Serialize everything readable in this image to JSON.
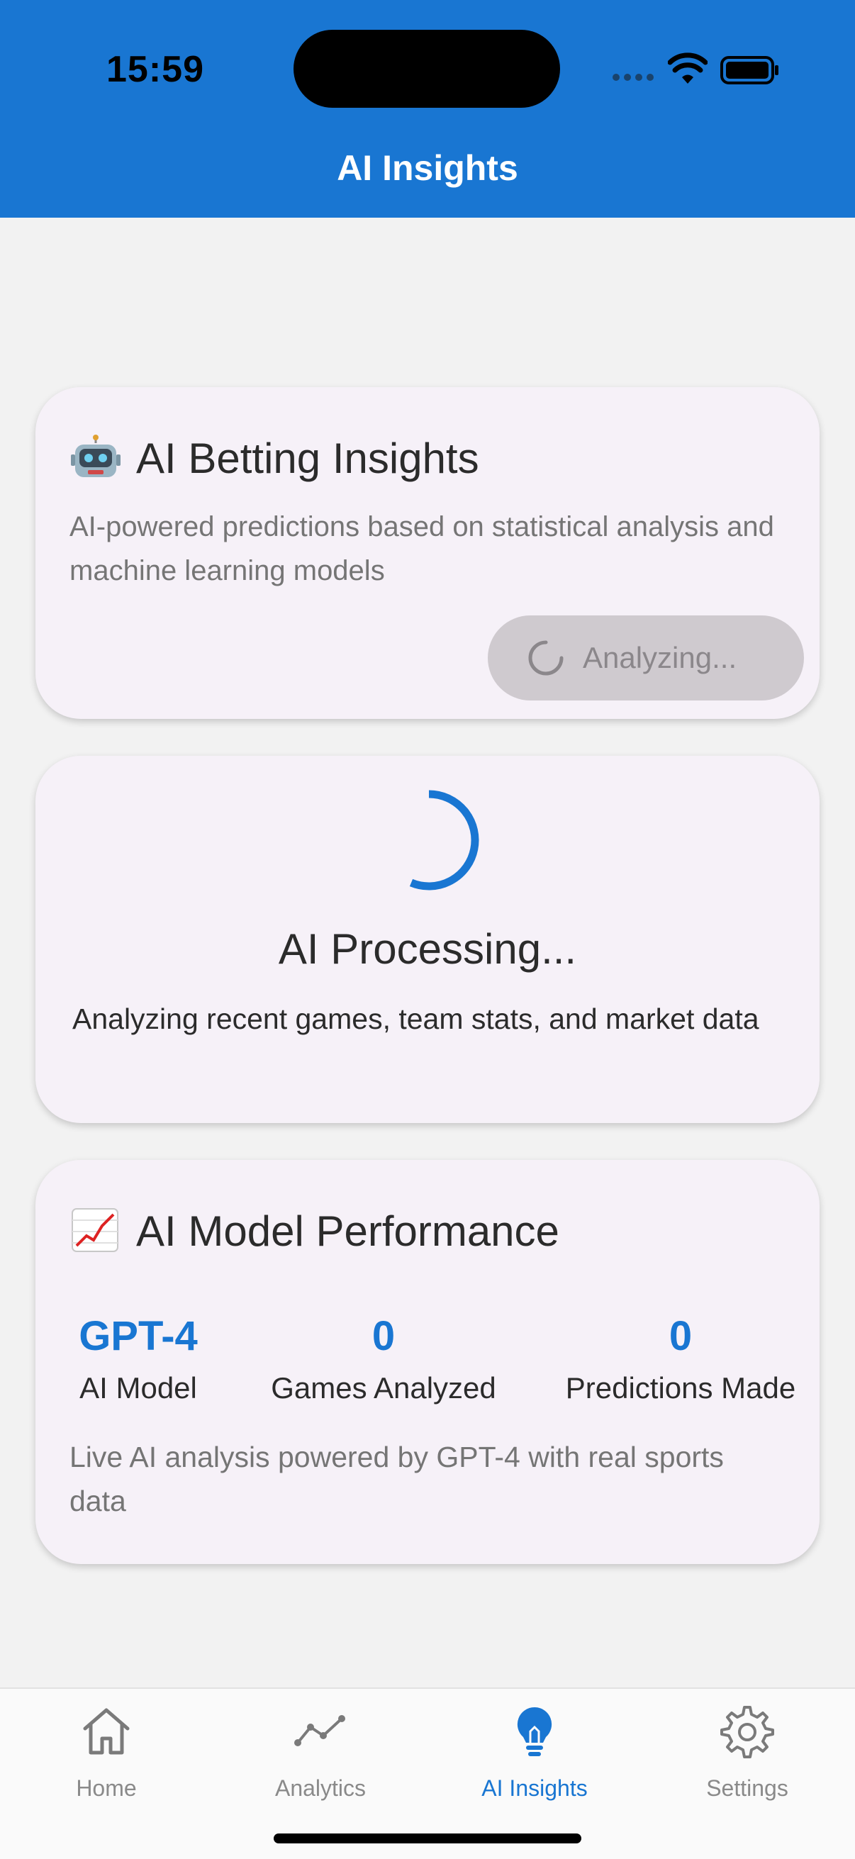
{
  "status_bar": {
    "time": "15:59"
  },
  "header": {
    "title": "AI Insights"
  },
  "insights_card": {
    "emoji_icon": "robot-emoji",
    "title": "AI Betting Insights",
    "description": "AI-powered predictions based on statistical analysis and machine learning models",
    "button_label": "Analyzing..."
  },
  "processing_card": {
    "title": "AI Processing...",
    "description": "Analyzing recent games, team stats, and market data"
  },
  "performance_card": {
    "emoji_icon": "chart-increasing-emoji",
    "title": "AI Model Performance",
    "stats": [
      {
        "value": "GPT-4",
        "label": "AI Model"
      },
      {
        "value": "0",
        "label": "Games Analyzed"
      },
      {
        "value": "0",
        "label": "Predictions Made"
      }
    ],
    "footnote": "Live AI analysis powered by GPT-4 with real sports data"
  },
  "bottom_nav": {
    "items": [
      {
        "label": "Home",
        "icon": "home-icon"
      },
      {
        "label": "Analytics",
        "icon": "analytics-icon"
      },
      {
        "label": "AI Insights",
        "icon": "lightbulb-icon",
        "active": true
      },
      {
        "label": "Settings",
        "icon": "gear-icon"
      }
    ]
  },
  "colors": {
    "primary": "#1976d2",
    "card_bg": "#f6f1f8",
    "page_bg": "#f2f2f2"
  }
}
